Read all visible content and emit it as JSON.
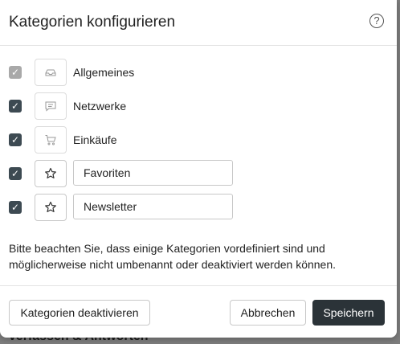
{
  "backdrop": {
    "text": "Verfassen & Antworten"
  },
  "dialog": {
    "title": "Kategorien konfigurieren",
    "help_glyph": "?"
  },
  "categories": [
    {
      "label": "Allgemeines",
      "checked": true,
      "editable": false,
      "icon": "inbox-icon"
    },
    {
      "label": "Netzwerke",
      "checked": true,
      "editable": false,
      "icon": "chat-bubble-icon"
    },
    {
      "label": "Einkäufe",
      "checked": true,
      "editable": false,
      "icon": "shopping-cart-icon"
    },
    {
      "value": "Favoriten",
      "checked": true,
      "editable": true,
      "icon": "star-icon"
    },
    {
      "value": "Newsletter",
      "checked": true,
      "editable": true,
      "icon": "star-icon"
    }
  ],
  "note": "Bitte beachten Sie, dass einige Kategorien vordefiniert sind und möglicherweise nicht umbenannt oder deaktiviert werden können.",
  "footer": {
    "deactivate_label": "Kategorien deaktivieren",
    "cancel_label": "Abbrechen",
    "save_label": "Speichern"
  }
}
